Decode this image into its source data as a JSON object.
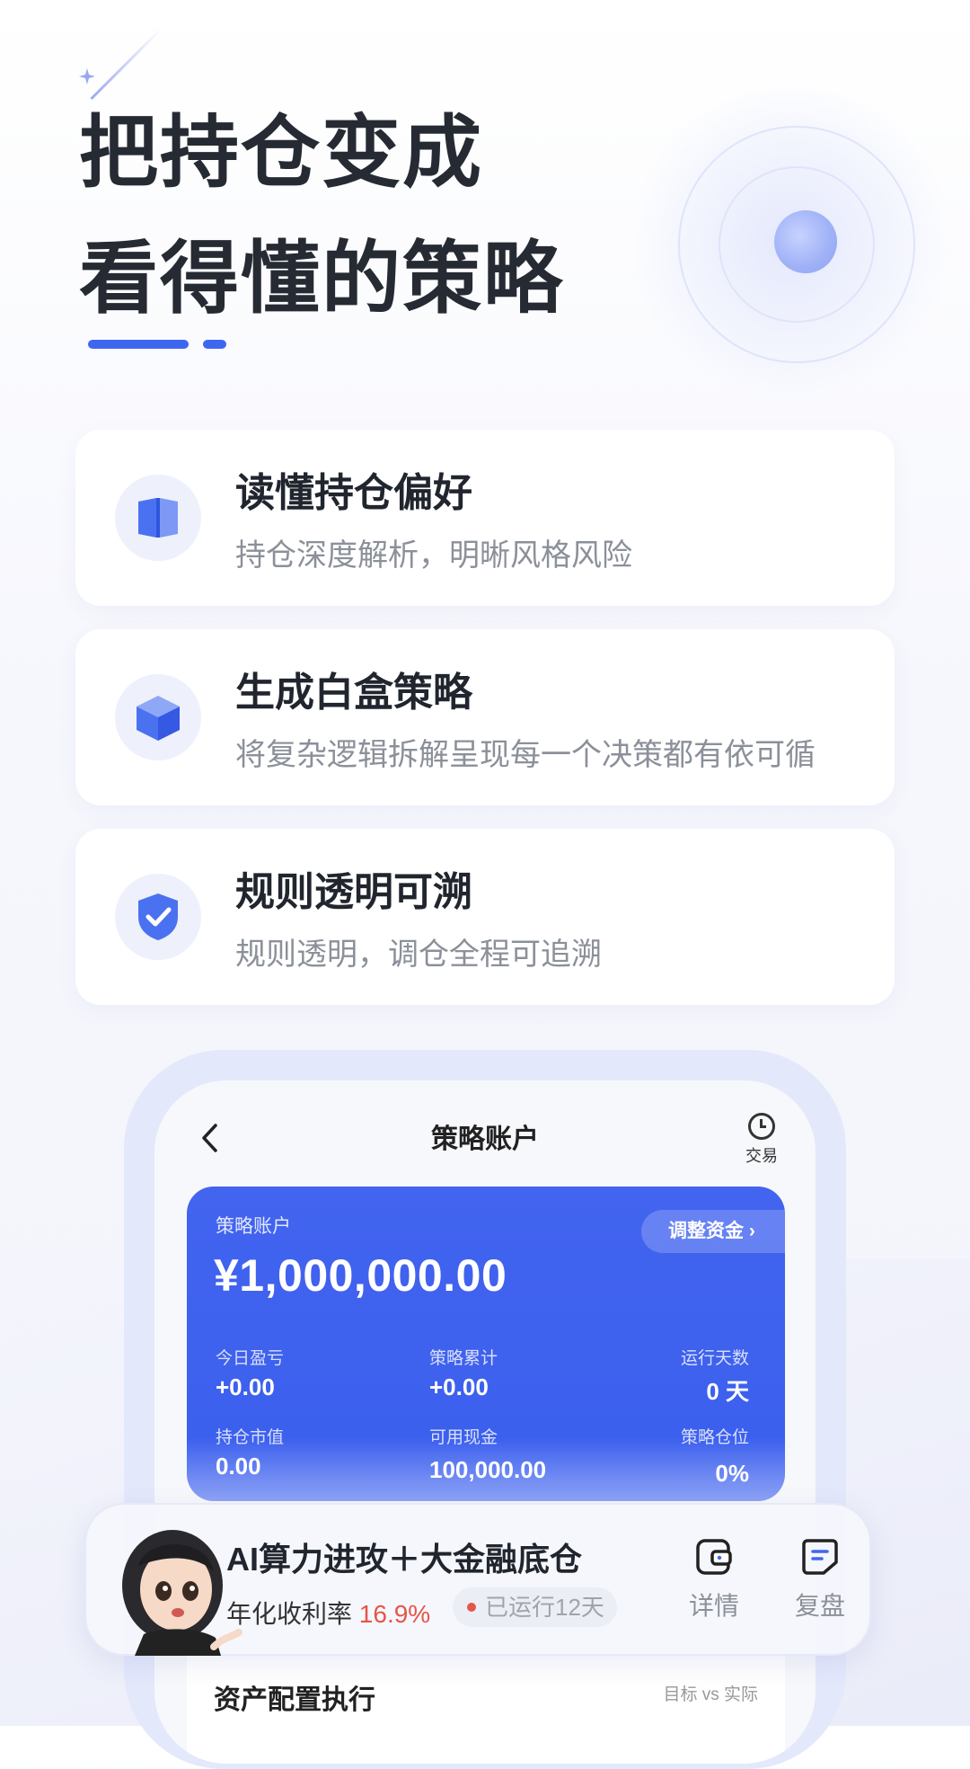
{
  "headline": {
    "line1": "把持仓变成",
    "line2": "看得懂的策略"
  },
  "features": [
    {
      "title": "读懂持仓偏好",
      "desc": "持仓深度解析，明晰风格风险",
      "icon": "book-icon"
    },
    {
      "title": "生成白盒策略",
      "desc": "将复杂逻辑拆解呈现每一个决策都有依可循",
      "icon": "cube-icon"
    },
    {
      "title": "规则透明可溯",
      "desc": "规则透明，调仓全程可追溯",
      "icon": "shield-check-icon"
    }
  ],
  "phone": {
    "title": "策略账户",
    "back_icon": "chevron-left-icon",
    "trade_label": "交易",
    "account": {
      "label": "策略账户",
      "amount": "¥1,000,000.00",
      "adjust_label": "调整资金",
      "stats": {
        "today_label": "今日盈亏",
        "today_value": "+0.00",
        "cumulative_label": "策略累计",
        "cumulative_value": "+0.00",
        "days_label": "运行天数",
        "days_value": "0 天",
        "market_label": "持仓市值",
        "market_value": "0.00",
        "cash_label": "可用现金",
        "cash_value": "100,000.00",
        "position_label": "策略仓位",
        "position_value": "0%"
      }
    },
    "asset": {
      "title": "资产配置执行",
      "subtitle": "目标 vs 实际"
    }
  },
  "strategy": {
    "title": "AI算力进攻＋大金融底仓",
    "yield_label": "年化收利率",
    "yield_value": "16.9%",
    "badge": "已运行12天",
    "detail_label": "详情",
    "review_label": "复盘"
  },
  "colors": {
    "accent": "#3e67f0",
    "card_blue": "#4264ef",
    "positive_red": "#e55548"
  }
}
